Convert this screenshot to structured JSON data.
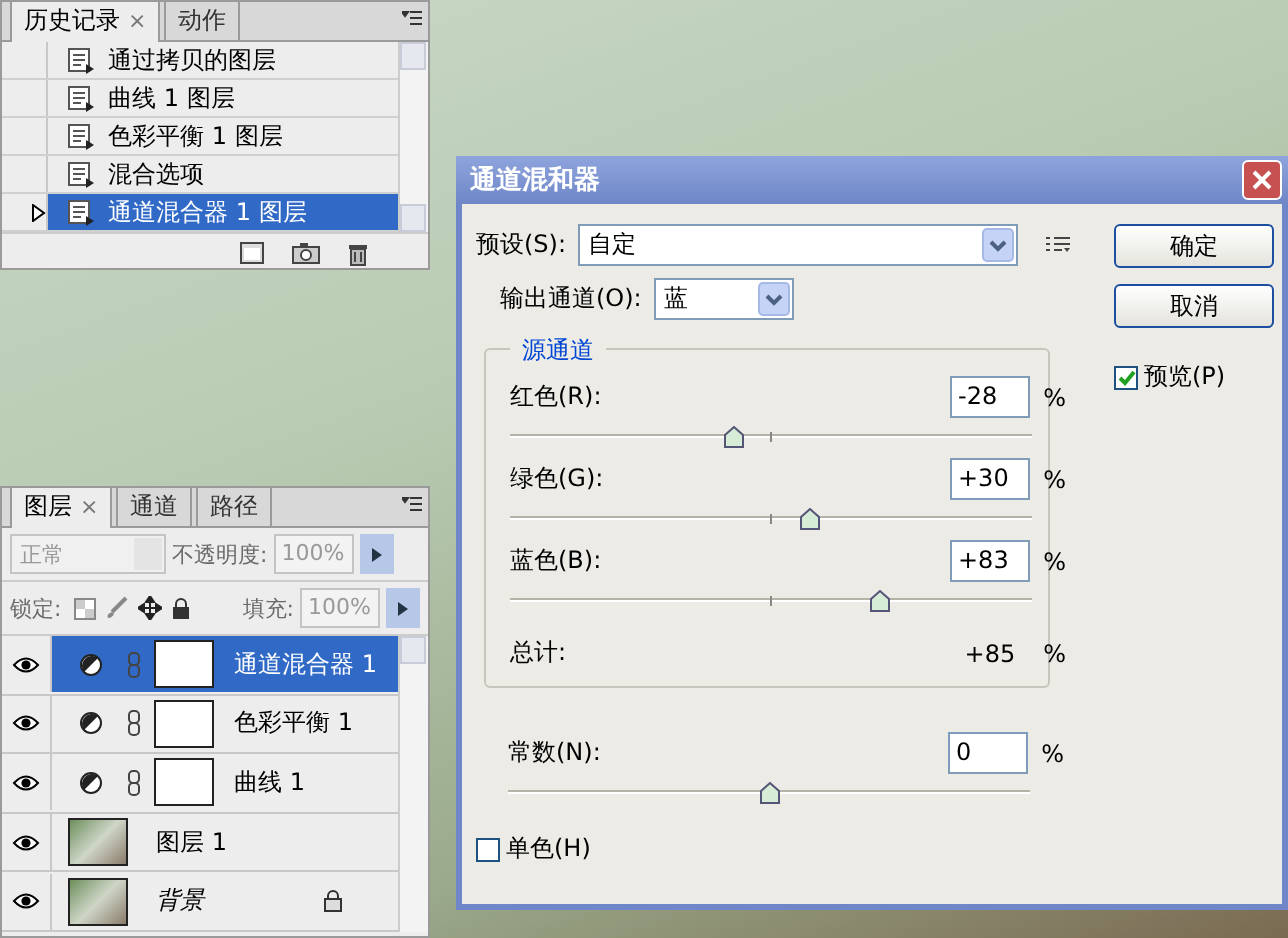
{
  "history_panel": {
    "tabs": [
      {
        "label": "历史记录",
        "selected": true,
        "close": "×"
      },
      {
        "label": "动作",
        "selected": false
      }
    ],
    "items": [
      {
        "label": "通过拷贝的图层",
        "selected": false
      },
      {
        "label": "曲线 1 图层",
        "selected": false
      },
      {
        "label": "色彩平衡 1 图层",
        "selected": false
      },
      {
        "label": "混合选项",
        "selected": false
      },
      {
        "label": "通道混合器 1 图层",
        "selected": true
      }
    ]
  },
  "layers_panel": {
    "tabs": [
      {
        "label": "图层",
        "selected": true,
        "close": "×"
      },
      {
        "label": "通道",
        "selected": false
      },
      {
        "label": "路径",
        "selected": false
      }
    ],
    "blend_mode": {
      "value": "正常",
      "disabled": true
    },
    "opacity_label": "不透明度:",
    "opacity": "100%",
    "lock_label": "锁定:",
    "fill_label": "填充:",
    "fill": "100%",
    "layers": [
      {
        "name": "通道混合器 1",
        "kind": "adjustment",
        "selected": true,
        "visible": true,
        "locked": false
      },
      {
        "name": "色彩平衡 1",
        "kind": "adjustment",
        "selected": false,
        "visible": true,
        "locked": false
      },
      {
        "name": "曲线 1",
        "kind": "adjustment",
        "selected": false,
        "visible": true,
        "locked": false
      },
      {
        "name": "图层 1",
        "kind": "image",
        "selected": false,
        "visible": true,
        "locked": false
      },
      {
        "name": "背景",
        "kind": "background",
        "selected": false,
        "visible": true,
        "locked": true
      }
    ]
  },
  "dialog": {
    "title": "通道混和器",
    "preset_label": "预设(S):",
    "preset": "自定",
    "output_label": "输出通道(O):",
    "output": "蓝",
    "buttons": [
      "确定",
      "取消"
    ],
    "preview": {
      "label": "预览(P)",
      "checked": true
    },
    "source_group": "源通道",
    "channels": [
      {
        "label": "红色(R):",
        "value": "-28",
        "unit": "%",
        "level": 0.43
      },
      {
        "label": "绿色(G):",
        "value": "+30",
        "unit": "%",
        "level": 0.575
      },
      {
        "label": "蓝色(B):",
        "value": "+83",
        "unit": "%",
        "level": 0.71
      }
    ],
    "total_label": "总计:",
    "total_value": "+85",
    "total_unit": "%",
    "constant": {
      "label": "常数(N):",
      "value": "0",
      "unit": "%",
      "level": 0.5
    },
    "monochrome": {
      "label": "单色(H)",
      "checked": false
    }
  }
}
